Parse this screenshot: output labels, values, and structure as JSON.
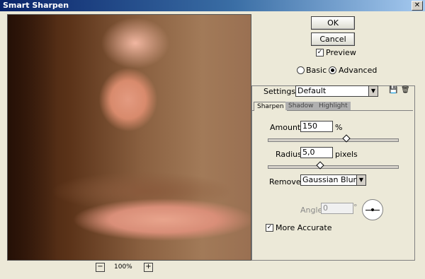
{
  "window": {
    "title": "Smart Sharpen",
    "close_glyph": "✕"
  },
  "dialog": {
    "ok_label": "OK",
    "cancel_label": "Cancel",
    "preview_label": "Preview",
    "preview_checked": true,
    "mode_basic_label": "Basic",
    "mode_advanced_label": "Advanced",
    "mode_selected": "Advanced"
  },
  "preview": {
    "zoom_level": "100%",
    "zoom_out_glyph": "−",
    "zoom_in_glyph": "+"
  },
  "settings": {
    "label": "Settings:",
    "value": "Default",
    "save_icon": "save-icon",
    "delete_icon": "trash-icon"
  },
  "tabs": [
    {
      "label": "Sharpen",
      "active": true
    },
    {
      "label": "Shadow",
      "active": false
    },
    {
      "label": "Highlight",
      "active": false
    }
  ],
  "amount": {
    "label": "Amount:",
    "value": "150",
    "unit": "%",
    "slider_fraction": 0.6
  },
  "radius": {
    "label": "Radius:",
    "value": "5,0",
    "unit": "pixels",
    "slider_fraction": 0.4
  },
  "remove": {
    "label": "Remove:",
    "value": "Gaussian Blur"
  },
  "angle": {
    "label": "Angle:",
    "value": "0",
    "unit": "°"
  },
  "more_accurate": {
    "label": "More Accurate",
    "checked": true
  }
}
